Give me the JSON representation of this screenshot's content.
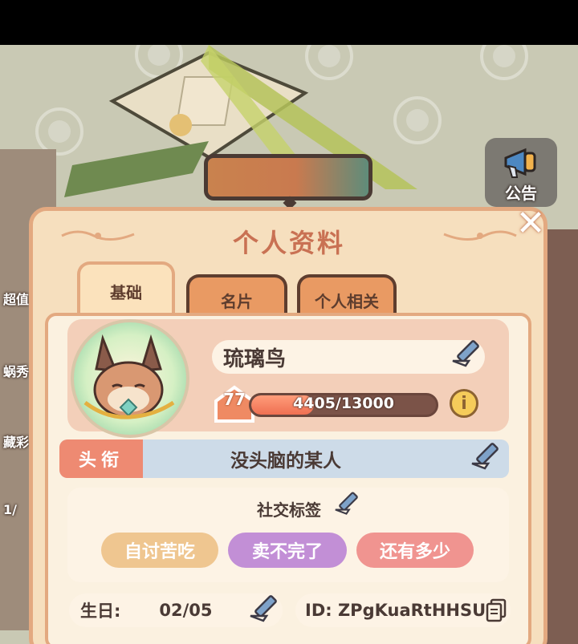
{
  "side_labels": [
    "超值",
    "蜗秀",
    "藏彩",
    "1/"
  ],
  "notice": {
    "label": "公告",
    "icon": "megaphone-icon"
  },
  "panel": {
    "title": "个人资料",
    "close_icon": "close-icon"
  },
  "tabs": [
    {
      "label": "基础",
      "active": true
    },
    {
      "label": "名片",
      "active": false
    },
    {
      "label": "个人相关",
      "active": false
    }
  ],
  "profile": {
    "name": "琉璃鸟",
    "level": "77",
    "xp_text": "4405/13000",
    "xp_current": 4405,
    "xp_max": 13000,
    "avatar_icon": "fox-avatar-icon"
  },
  "title_field": {
    "label": "头衔",
    "value": "没头脑的某人"
  },
  "tags": {
    "heading": "社交标签",
    "items": [
      {
        "label": "自讨苦吃",
        "color": "#efc690"
      },
      {
        "label": "卖不完了",
        "color": "#c28fd6"
      },
      {
        "label": "还有多少",
        "color": "#f09490"
      }
    ]
  },
  "birthday": {
    "label": "生日:",
    "value": "02/05"
  },
  "player_id": {
    "text": "ID: ZPgKuaRtHHSU"
  },
  "colors": {
    "panel_bg": "#f6dfbe",
    "accent": "#e3a980",
    "title": "#c97153"
  }
}
